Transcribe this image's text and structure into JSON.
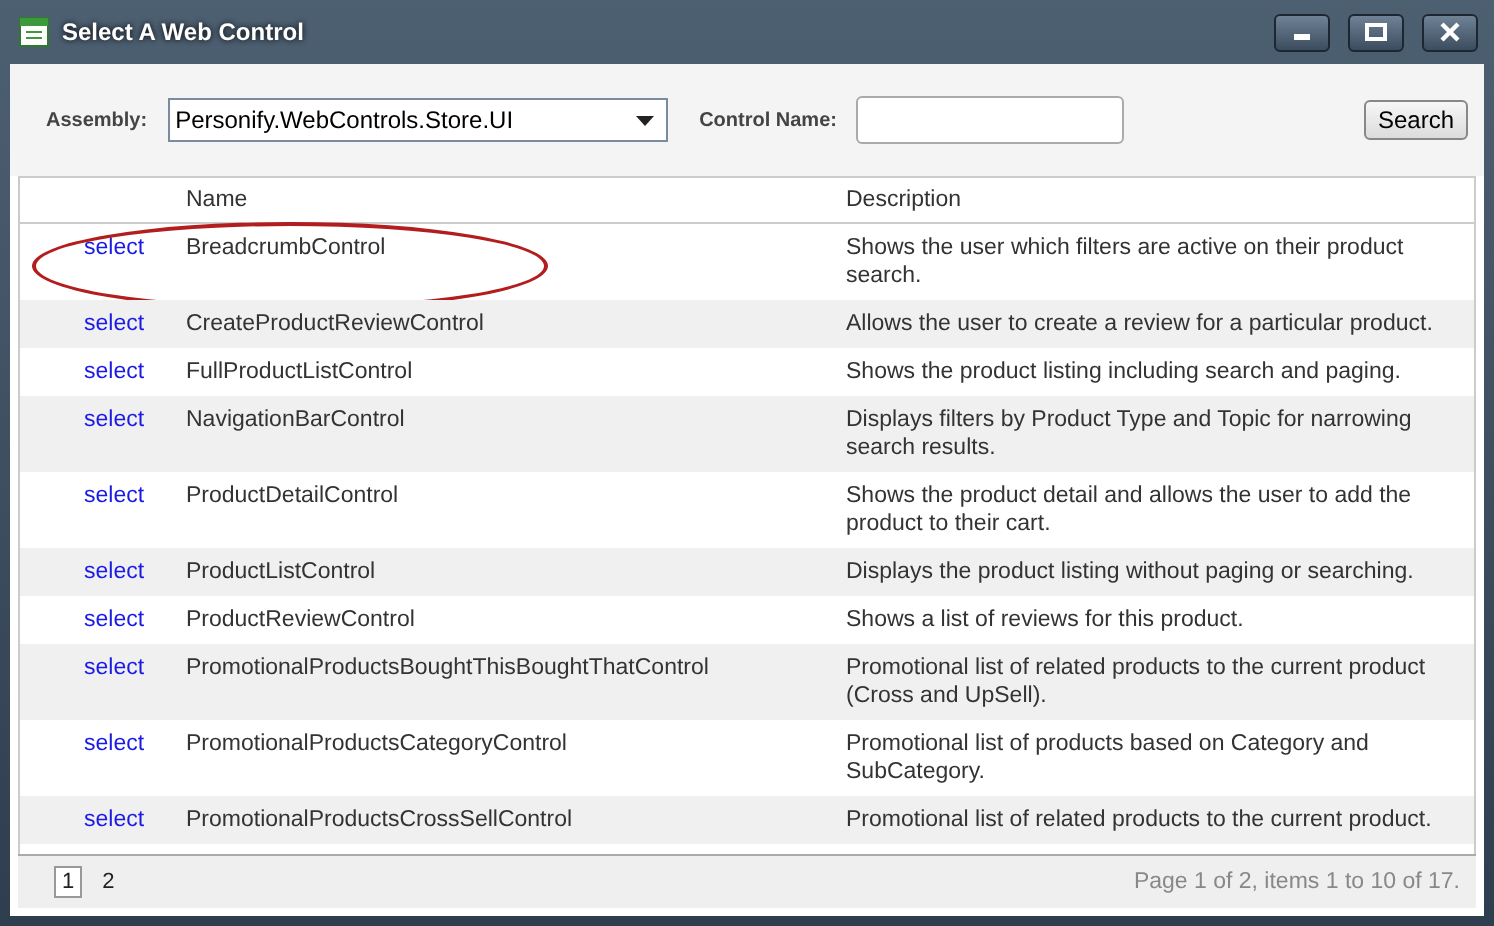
{
  "window": {
    "title": "Select A Web Control"
  },
  "filters": {
    "assembly_label": "Assembly:",
    "assembly_value": "Personify.WebControls.Store.UI",
    "control_name_label": "Control Name:",
    "search_button": "Search"
  },
  "table": {
    "columns": [
      "Name",
      "Description"
    ],
    "rows": [
      {
        "action": "select",
        "name": "BreadcrumbControl",
        "description": "Shows the user which filters are active on their product search.",
        "highlighted": true
      },
      {
        "action": "select",
        "name": "CreateProductReviewControl",
        "description": "Allows the user to create a review for a particular product.",
        "highlighted": false
      },
      {
        "action": "select",
        "name": "FullProductListControl",
        "description": "Shows the product listing including search and paging.",
        "highlighted": false
      },
      {
        "action": "select",
        "name": "NavigationBarControl",
        "description": "Displays filters by Product Type and Topic for narrowing search results.",
        "highlighted": false
      },
      {
        "action": "select",
        "name": "ProductDetailControl",
        "description": "Shows the product detail and allows the user to add the product to their cart.",
        "highlighted": false
      },
      {
        "action": "select",
        "name": "ProductListControl",
        "description": "Displays the product listing without paging or searching.",
        "highlighted": false
      },
      {
        "action": "select",
        "name": "ProductReviewControl",
        "description": "Shows a list of reviews for this product.",
        "highlighted": false
      },
      {
        "action": "select",
        "name": "PromotionalProductsBoughtThisBoughtThatControl",
        "description": "Promotional list of related products to the current product (Cross and UpSell).",
        "highlighted": false
      },
      {
        "action": "select",
        "name": "PromotionalProductsCategoryControl",
        "description": "Promotional list of products based on Category and SubCategory.",
        "highlighted": false
      },
      {
        "action": "select",
        "name": "PromotionalProductsCrossSellControl",
        "description": "Promotional list of related products to the current product.",
        "highlighted": false
      }
    ]
  },
  "pager": {
    "pages": [
      {
        "label": "1",
        "selected": true
      },
      {
        "label": "2",
        "selected": false
      }
    ],
    "summary": "Page 1 of 2, items 1 to 10 of 17."
  }
}
